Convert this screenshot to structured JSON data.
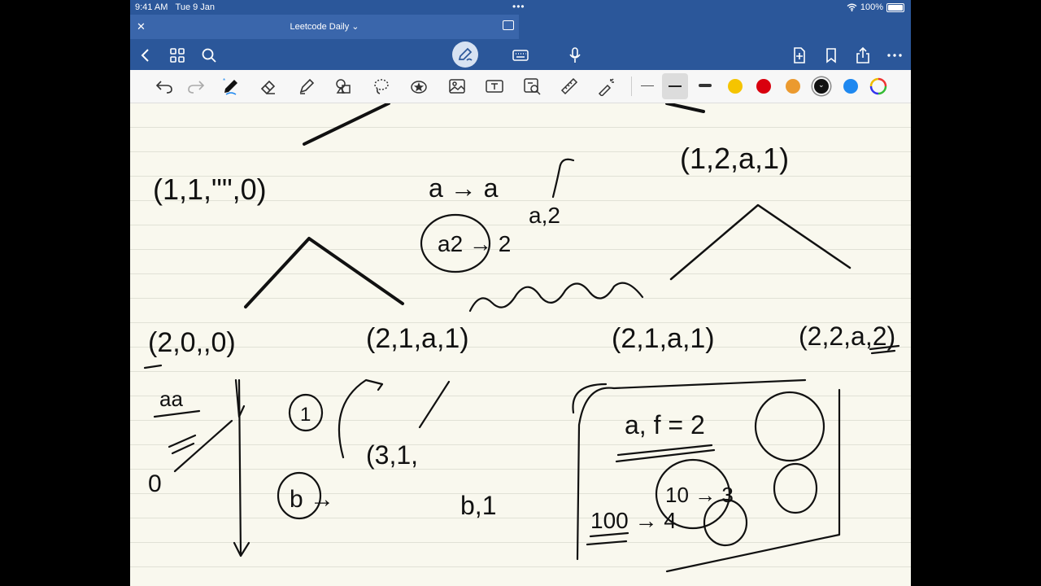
{
  "status_bar": {
    "time": "9:41 AM",
    "date": "Tue 9 Jan",
    "battery": "100%"
  },
  "document": {
    "title": "Leetcode Daily"
  },
  "toolbar": {
    "top_icons": [
      "back-icon",
      "grid-icon",
      "search-icon",
      "pen-mode-icon",
      "keyboard-icon",
      "microphone-icon",
      "add-page-icon",
      "bookmark-icon",
      "share-icon",
      "more-icon"
    ],
    "tools": [
      "undo-icon",
      "redo-icon",
      "pen-tool-icon",
      "eraser-icon",
      "highlighter-icon",
      "shapes-icon",
      "lasso-icon",
      "sticker-icon",
      "image-icon",
      "text-box-icon",
      "scan-icon",
      "ruler-icon",
      "laser-pointer-icon"
    ],
    "stroke_widths": [
      "thin",
      "medium",
      "thick"
    ],
    "selected_stroke": "medium",
    "colors": [
      "#f5c400",
      "#d9000e",
      "#eb9a2f",
      "#111111",
      "#1e88f0"
    ],
    "selected_color": "#111111"
  },
  "canvas": {
    "ink_color": "#111111",
    "paper_color": "#f9f8ee",
    "handwriting": [
      "(1,1,\"\",0)",
      "a → a",
      "a,2",
      "a2 → 2",
      "(1,2,a,1)",
      "(2,0,,0)",
      "(2,1,a,1)",
      "(2,1,a,1)",
      "(2,2,a,2)",
      "aa",
      "1",
      "(3,1,",
      "b →",
      "b,1",
      "a, f = 2",
      "10 → 3",
      "100 → 4",
      "0"
    ]
  }
}
